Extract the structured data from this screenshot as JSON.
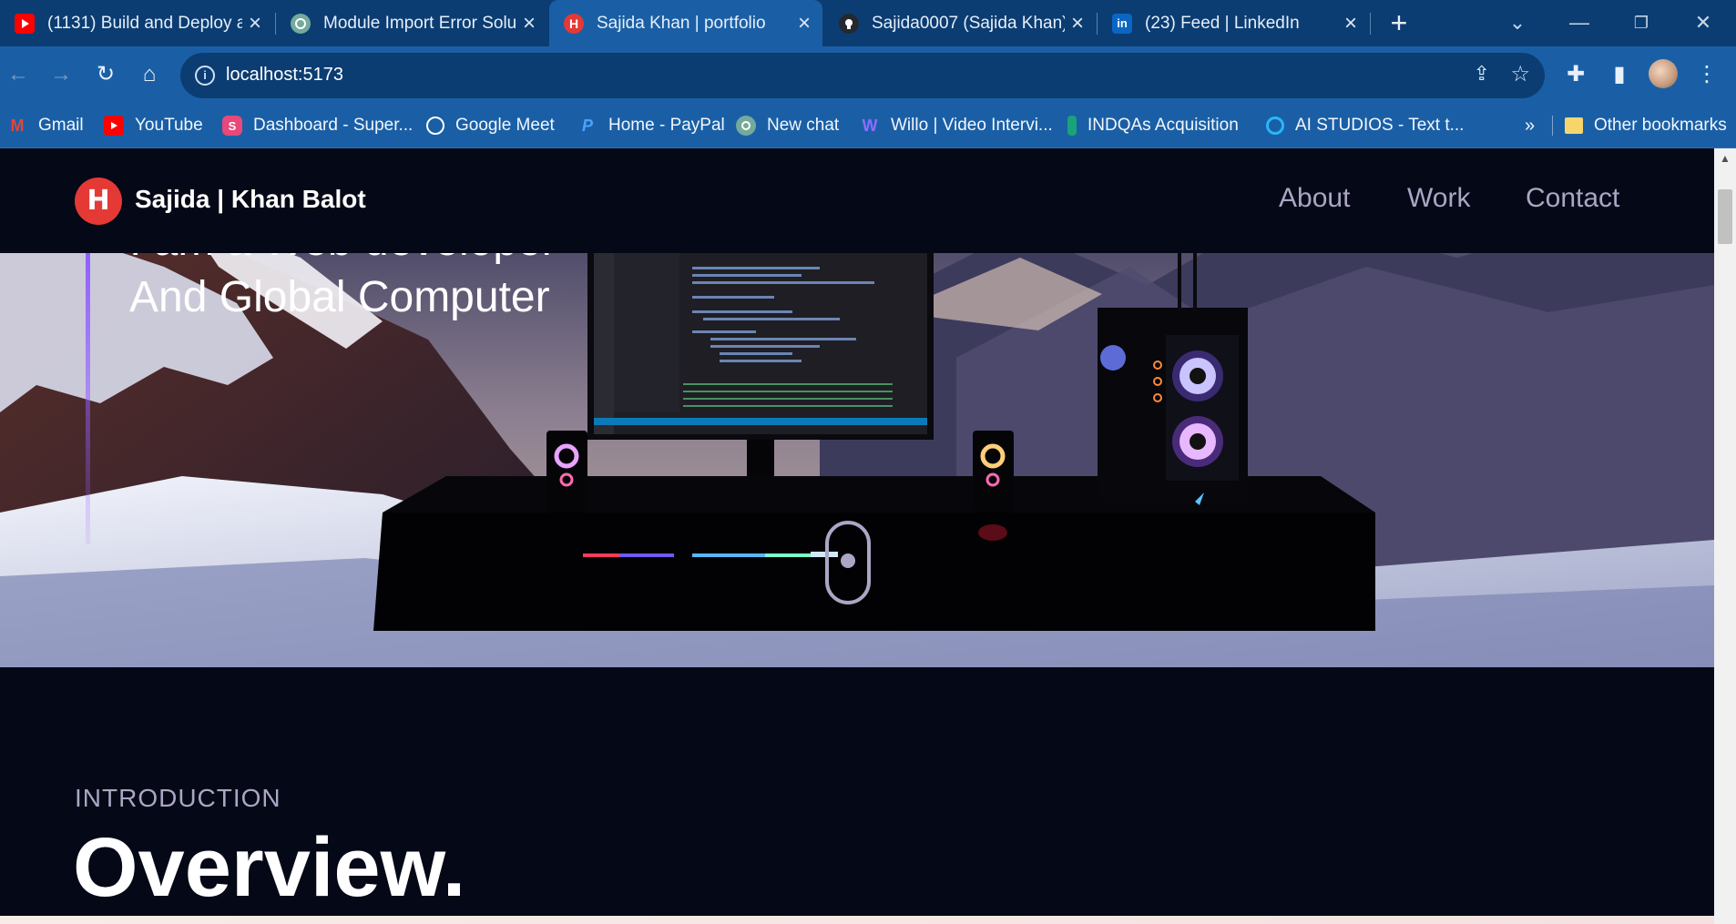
{
  "browser": {
    "tabs": [
      {
        "title": "(1131) Build and Deploy a",
        "icon": "youtube-icon",
        "color": "#ff0000"
      },
      {
        "title": "Module Import Error Solu",
        "icon": "chatgpt-icon",
        "color": "#74aa9c"
      },
      {
        "title": "Sajida Khan | portfolio",
        "icon": "portfolio-icon",
        "color": "#e53935"
      },
      {
        "title": "Sajida0007 (Sajida Khan)",
        "icon": "github-icon",
        "color": "#24292f"
      },
      {
        "title": "(23) Feed | LinkedIn",
        "icon": "linkedin-icon",
        "color": "#0a66c2"
      }
    ],
    "new_tab": "+",
    "address": "localhost:5173",
    "bookmarks": [
      {
        "label": "Gmail",
        "icon": "gmail-icon",
        "color": "#ea4335"
      },
      {
        "label": "YouTube",
        "icon": "youtube-icon",
        "color": "#ff0000"
      },
      {
        "label": "Dashboard - Super...",
        "icon": "dashboard-icon",
        "color": "#e8487a"
      },
      {
        "label": "Google Meet",
        "icon": "globe-icon",
        "color": "#ffffff"
      },
      {
        "label": "Home - PayPal",
        "icon": "paypal-icon",
        "color": "#1e88e5"
      },
      {
        "label": "New chat",
        "icon": "chatgpt-icon",
        "color": "#74aa9c"
      },
      {
        "label": "Willo | Video Intervi...",
        "icon": "willo-icon",
        "color": "#6b4ce6"
      },
      {
        "label": "INDQAs Acquisition",
        "icon": "indqas-icon",
        "color": "#1aa37a"
      },
      {
        "label": "AI STUDIOS - Text t...",
        "icon": "aistudios-icon",
        "color": "#29b6f6"
      }
    ],
    "overflow": "»",
    "other_bookmarks": "Other bookmarks"
  },
  "page": {
    "brand": "Sajida  | Khan Balot",
    "logo_letter": "H",
    "nav": [
      "About",
      "Work",
      "Contact"
    ],
    "hero_line1": "I am a Web developer",
    "hero_line2": "And Global Computer",
    "intro_subtitle": "INTRODUCTION",
    "intro_heading": "Overview."
  },
  "colors": {
    "page_bg": "#050816",
    "accent": "#915eff",
    "nav_text": "#aaa6c3",
    "chrome_dark": "#0b3d73",
    "chrome_light": "#1a5fa6"
  }
}
